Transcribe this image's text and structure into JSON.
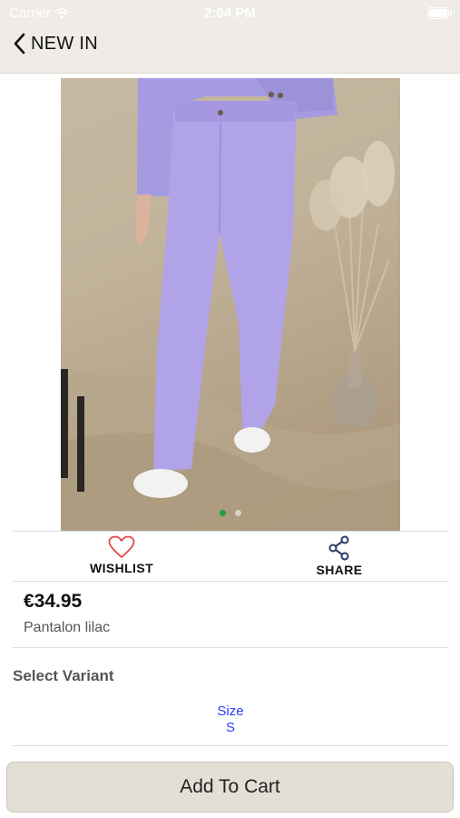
{
  "status_bar": {
    "carrier": "Carrier",
    "time": "2:04 PM"
  },
  "nav": {
    "back_icon": "chevron-left-icon",
    "title": "NEW IN"
  },
  "gallery": {
    "image_count": 2,
    "active_index": 0
  },
  "actions": {
    "wishlist": {
      "icon": "heart-icon",
      "label": "WISHLIST"
    },
    "share": {
      "icon": "share-icon",
      "label": "SHARE"
    }
  },
  "product": {
    "price": "€34.95",
    "name": "Pantalon lilac"
  },
  "variant": {
    "heading": "Select Variant",
    "option_label": "Size",
    "option_value": "S"
  },
  "cart_button": {
    "label": "Add To Cart"
  },
  "colors": {
    "navbar_bg": "#efece7",
    "accent_green": "#1c9e3a",
    "link_blue": "#2a3cff",
    "button_bg": "#e3dfd4"
  }
}
